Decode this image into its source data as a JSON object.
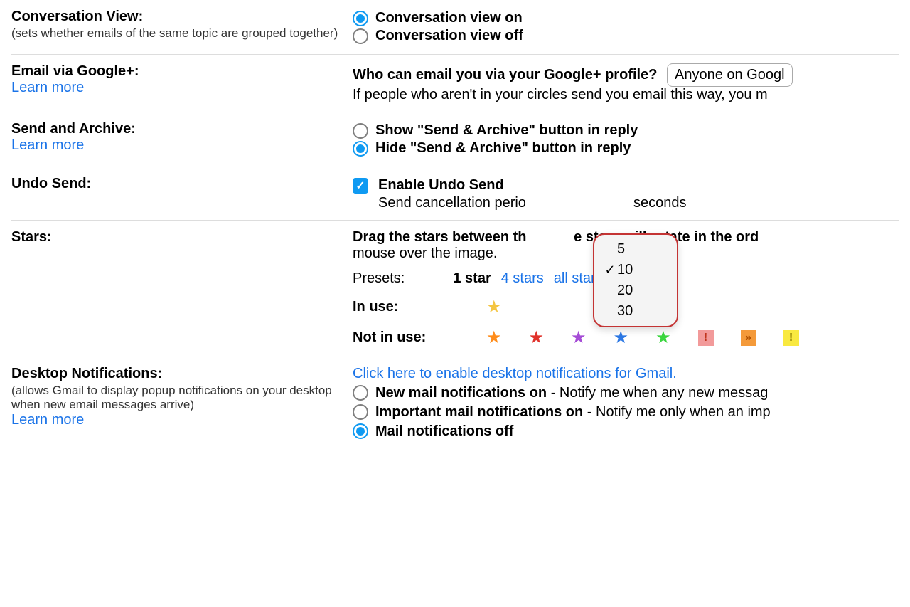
{
  "conversationView": {
    "title": "Conversation View:",
    "hint": "(sets whether emails of the same topic are grouped together)",
    "options": {
      "on": "Conversation view on",
      "off": "Conversation view off"
    },
    "selected": "on"
  },
  "emailViaGPlus": {
    "title": "Email via Google+:",
    "learn": "Learn more",
    "question": "Who can email you via your Google+ profile?",
    "selectValue": "Anyone on Googl",
    "hint": "If people who aren't in your circles send you email this way, you m"
  },
  "sendArchive": {
    "title": "Send and Archive:",
    "learn": "Learn more",
    "options": {
      "show": "Show \"Send & Archive\" button in reply",
      "hide": "Hide \"Send & Archive\" button in reply"
    },
    "selected": "hide"
  },
  "undoSend": {
    "title": "Undo Send:",
    "enableLabel": "Enable Undo Send",
    "periodPrefix": "Send cancellation perio",
    "periodSuffix": "seconds",
    "options": [
      "5",
      "10",
      "20",
      "30"
    ],
    "selected": "10"
  },
  "stars": {
    "title": "Stars:",
    "instr": "Drag the stars between th            e stars will rotate in the ord",
    "instr2": "mouse over the image.",
    "presetsLabel": "Presets:",
    "presets": {
      "one": "1 star",
      "four": "4 stars",
      "all": "all stars"
    },
    "inUseLabel": "In use:",
    "notInUseLabel": "Not in use:",
    "inUse": [
      {
        "glyph": "★",
        "color": "#f4c542"
      }
    ],
    "notInUse": [
      {
        "type": "star",
        "glyph": "★",
        "color": "#ff8c1a"
      },
      {
        "type": "star",
        "glyph": "★",
        "color": "#e0322b"
      },
      {
        "type": "star",
        "glyph": "★",
        "color": "#a54cd6"
      },
      {
        "type": "star",
        "glyph": "★",
        "color": "#2c78e4"
      },
      {
        "type": "star",
        "glyph": "★",
        "color": "#3bd63f"
      },
      {
        "type": "square",
        "glyph": "!",
        "bg": "#f29a9a",
        "fg": "#c0341c"
      },
      {
        "type": "square",
        "glyph": "»",
        "bg": "#f49a3a",
        "fg": "#b05000"
      },
      {
        "type": "square",
        "glyph": "!",
        "bg": "#f9e940",
        "fg": "#8a7a00"
      }
    ]
  },
  "desktopNotif": {
    "title": "Desktop Notifications:",
    "hint": "(allows Gmail to display popup notifications on your desktop when new email messages arrive)",
    "learn": "Learn more",
    "enableLink": "Click here to enable desktop notifications for Gmail.",
    "options": {
      "new": {
        "bold": "New mail notifications on",
        "rest": " - Notify me when any new messag"
      },
      "imp": {
        "bold": "Important mail notifications on",
        "rest": " - Notify me only when an imp"
      },
      "off": {
        "bold": "Mail notifications off",
        "rest": ""
      }
    },
    "selected": "off"
  }
}
